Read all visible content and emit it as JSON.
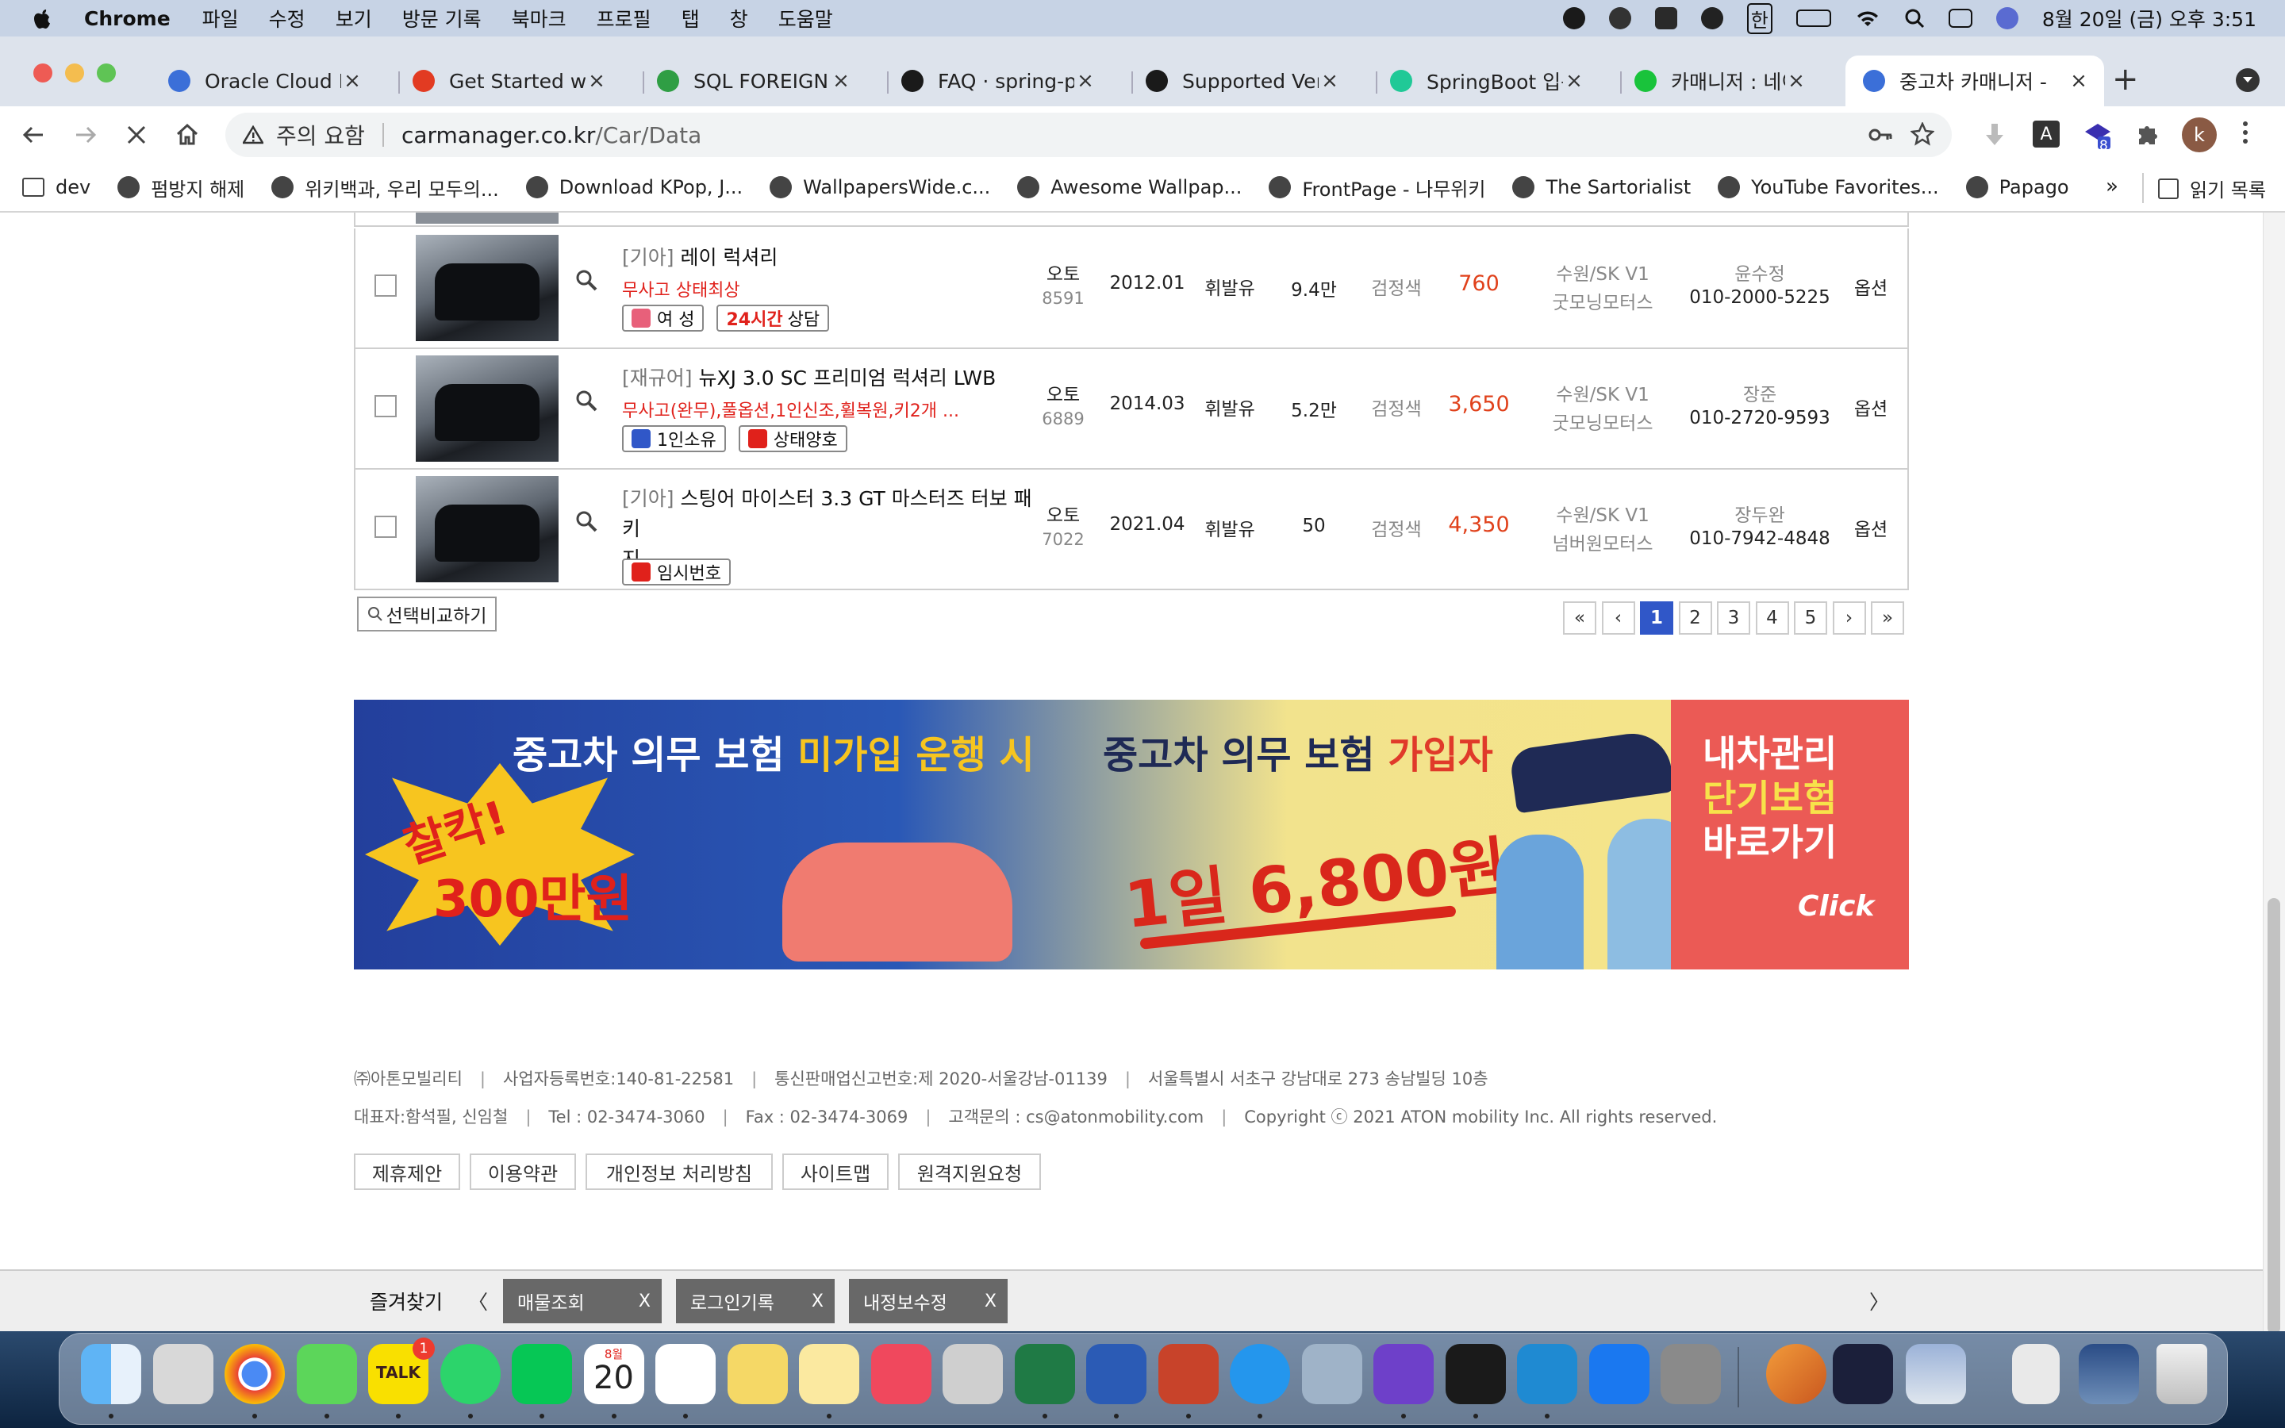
{
  "menubar": {
    "app": "Chrome",
    "items": [
      "파일",
      "수정",
      "보기",
      "방문 기록",
      "북마크",
      "프로필",
      "탭",
      "창",
      "도움말"
    ],
    "datetime": "8월 20일 (금) 오후 3:51",
    "ime": "한"
  },
  "tabs": [
    {
      "title": "Oracle Cloud Inf",
      "icon": "cloud-icon",
      "color": "#3b6fd8"
    },
    {
      "title": "Get Started with",
      "icon": "adobe-icon",
      "color": "#e23b22"
    },
    {
      "title": "SQL FOREIGN KE",
      "icon": "w3schools-icon",
      "color": "#2f9e44"
    },
    {
      "title": "FAQ · spring-pro",
      "icon": "github-icon",
      "color": "#1a1a1a"
    },
    {
      "title": "Supported Versio",
      "icon": "github-icon",
      "color": "#1a1a1a"
    },
    {
      "title": "SpringBoot 입문",
      "icon": "velog-icon",
      "color": "#20c997"
    },
    {
      "title": "카매니저 : 네이버",
      "icon": "naver-icon",
      "color": "#19c33b"
    },
    {
      "title": "중고차 카매니저 -",
      "icon": "loading-icon",
      "color": "#3b6fd8",
      "active": true
    }
  ],
  "toolbar": {
    "security_label": "주의 요함",
    "url_host": "carmanager.co.kr",
    "url_path": "/Car/Data",
    "profile_initial": "k",
    "ext_badge": "8"
  },
  "bookmarks": [
    {
      "label": "dev",
      "icon": "folder-icon"
    },
    {
      "label": "펌방지 해제",
      "icon": "globe-icon"
    },
    {
      "label": "위키백과, 우리 모두의...",
      "icon": "wikipedia-icon"
    },
    {
      "label": "Download KPop, J...",
      "icon": "globe-icon"
    },
    {
      "label": "WallpapersWide.c...",
      "icon": "wallpaper-icon"
    },
    {
      "label": "Awesome Wallpap...",
      "icon": "globe-icon"
    },
    {
      "label": "FrontPage - 나무위키",
      "icon": "namuwiki-icon"
    },
    {
      "label": "The Sartorialist",
      "icon": "globe-icon"
    },
    {
      "label": "YouTube Favorites...",
      "icon": "globe-icon"
    },
    {
      "label": "Papago",
      "icon": "globe-icon"
    }
  ],
  "bookmarks_more": "»",
  "reading_list": "읽기 목록",
  "listings": [
    {
      "brand": "[기아]",
      "model": "레이 럭셔리",
      "model_cont": "",
      "desc": "무사고 상태최상",
      "badges": [
        {
          "text": "여 성",
          "icon": "female-icon",
          "color": "#e8607a"
        },
        {
          "pre": "24시간",
          "text": "상담",
          "icon": "",
          "color": ""
        }
      ],
      "transmission": "오토",
      "code": "8591",
      "year": "2012.01",
      "fuel": "휘발유",
      "mileage": "9.4만",
      "color": "검정색",
      "price": "760",
      "dealer_loc": "수원/SK V1",
      "dealer_name": "굿모닝모터스",
      "contact_name": "윤수정",
      "phone": "010-2000-5225",
      "option": "옵션"
    },
    {
      "brand": "[재규어]",
      "model": "뉴XJ 3.0 SC 프리미엄 럭셔리 LWB",
      "model_cont": "",
      "desc": "무사고(완무),풀옵션,1인신조,휠복원,키2개 ...",
      "badges": [
        {
          "text": "1인소유",
          "icon": "owner-icon",
          "color": "#3057c8"
        },
        {
          "text": "상태양호",
          "icon": "car-check-icon",
          "color": "#e0211b"
        }
      ],
      "transmission": "오토",
      "code": "6889",
      "year": "2014.03",
      "fuel": "휘발유",
      "mileage": "5.2만",
      "color": "검정색",
      "price": "3,650",
      "dealer_loc": "수원/SK V1",
      "dealer_name": "굿모닝모터스",
      "contact_name": "장준",
      "phone": "010-2720-9593",
      "option": "옵션"
    },
    {
      "brand": "[기아]",
      "model": "스팅어 마이스터 3.3 GT 마스터즈 터보 패키",
      "model_cont": "지",
      "desc": "",
      "badges": [
        {
          "text": "임시번호",
          "icon": "temp-plate-icon",
          "color": "#e0211b"
        }
      ],
      "transmission": "오토",
      "code": "7022",
      "year": "2021.04",
      "fuel": "휘발유",
      "mileage": "50",
      "color": "검정색",
      "price": "4,350",
      "dealer_loc": "수원/SK V1",
      "dealer_name": "넘버원모터스",
      "contact_name": "장두완",
      "phone": "010-7942-4848",
      "option": "옵션"
    }
  ],
  "compare_button": "선택비교하기",
  "pagination": {
    "first": "«",
    "prev": "‹",
    "pages": [
      "1",
      "2",
      "3",
      "4",
      "5"
    ],
    "current": "1",
    "next": "›",
    "last": "»"
  },
  "banner": {
    "left_head_a": "중고차 의무 보험 ",
    "left_head_b": "미가입 운행 시",
    "burst_a": "찰칵!",
    "burst_b": "300만원",
    "right_head_a": "중고차 의무 보험 ",
    "right_head_b": "가입자",
    "price": "1일  6,800원",
    "side_1": "내차관리",
    "side_2": "단기보험",
    "side_3": "바로가기",
    "click": "Click"
  },
  "footer": {
    "line1": [
      "㈜아톤모빌리티",
      "사업자등록번호:140-81-22581",
      "통신판매업신고번호:제 2020-서울강남-01139",
      "서울특별시 서초구 강남대로 273 송남빌딩 10층"
    ],
    "line2": [
      "대표자:함석필, 신임철",
      "Tel : 02-3474-3060",
      "Fax : 02-3474-3069",
      "고객문의 : cs@atonmobility.com",
      "Copyright ⓒ 2021 ATON mobility Inc. All rights reserved."
    ],
    "links": [
      "제휴제안",
      "이용약관",
      "개인정보 처리방침",
      "사이트맵",
      "원격지원요청"
    ]
  },
  "favorites": {
    "label": "즐겨찾기",
    "prev": "〈",
    "next": "〉",
    "tabs": [
      "매물조회",
      "로그인기록",
      "내정보수정"
    ],
    "close": "X"
  },
  "dock": {
    "apps": [
      "finder",
      "launchpad",
      "chrome",
      "messages",
      "kakaotalk",
      "whatsapp",
      "line",
      "calendar",
      "reminders",
      "stickies",
      "notes",
      "music",
      "screenshot",
      "excel",
      "word",
      "powerpoint",
      "docker",
      "sequel",
      "github-desktop",
      "terminal",
      "vscode",
      "app-store",
      "system-preferences"
    ],
    "kakao_badge": "1",
    "kakao_label": "TALK",
    "calendar_month": "8월",
    "calendar_day": "20"
  }
}
